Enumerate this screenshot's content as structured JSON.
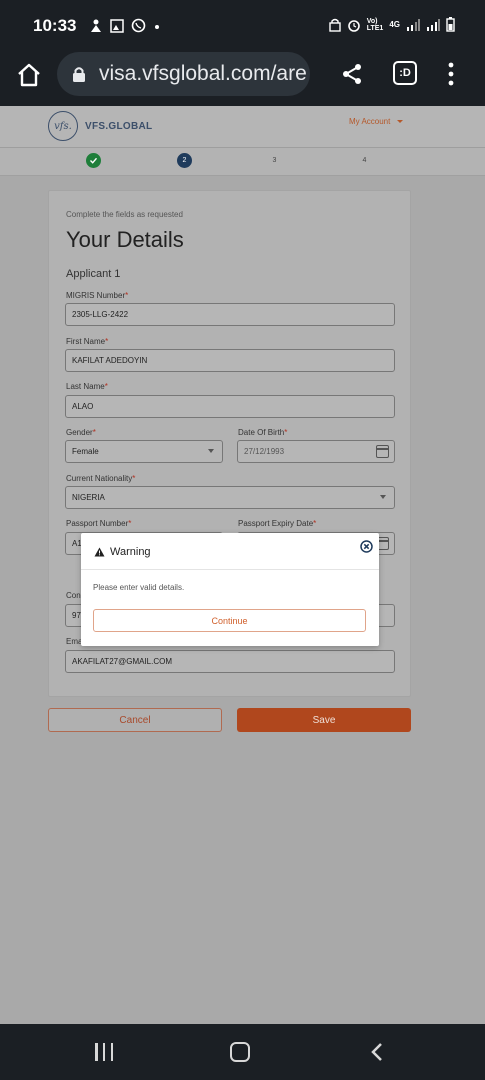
{
  "status_bar": {
    "time": "10:33",
    "left_icons": [
      "notification-icon",
      "gallery-icon",
      "whatsapp-icon",
      "dot-icon"
    ],
    "right_icons": [
      "vpn-icon",
      "alarm-icon",
      "volte-icon",
      "4g-icon",
      "signal-icon",
      "signal-icon",
      "battery-icon"
    ],
    "volte_label": "Vo)\nLTE1",
    "network": "4G"
  },
  "browser": {
    "url": "visa.vfsglobal.com/are",
    "tabs_label": ":D"
  },
  "site": {
    "logo_mark": "vfs.",
    "logo_text": "VFS.GLOBAL",
    "account_label": "My Account"
  },
  "stepper": {
    "steps": [
      {
        "label": "",
        "state": "done"
      },
      {
        "label": "2",
        "state": "current"
      },
      {
        "label": "3",
        "state": "todo"
      },
      {
        "label": "4",
        "state": "todo"
      }
    ]
  },
  "form": {
    "hint": "Complete the fields as requested",
    "title": "Your Details",
    "applicant": "Applicant 1",
    "migris_label": "MIGRIS Number",
    "migris_value": "2305-LLG-2422",
    "first_name_label": "First Name",
    "first_name_value": "KAFILAT ADEDOYIN",
    "last_name_label": "Last Name",
    "last_name_value": "ALAO",
    "gender_label": "Gender",
    "gender_value": "Female",
    "dob_label": "Date Of Birth",
    "dob_value": "27/12/1993",
    "nationality_label": "Current Nationality",
    "nationality_value": "NIGERIA",
    "passport_label": "Passport Number",
    "passport_value": "A1",
    "passport_expiry_label": "Passport Expiry Date",
    "contact_label": "Con",
    "contact_value": "97",
    "email_label": "Ema",
    "email_value": "AKAFILAT27@GMAIL.COM",
    "required_mark": "*"
  },
  "actions": {
    "cancel": "Cancel",
    "save": "Save"
  },
  "modal": {
    "title": "Warning",
    "message": "Please enter valid details.",
    "continue": "Continue"
  },
  "colors": {
    "brand": "#3c4f6a",
    "accent": "#b0471d",
    "success": "#1e7e3a"
  }
}
